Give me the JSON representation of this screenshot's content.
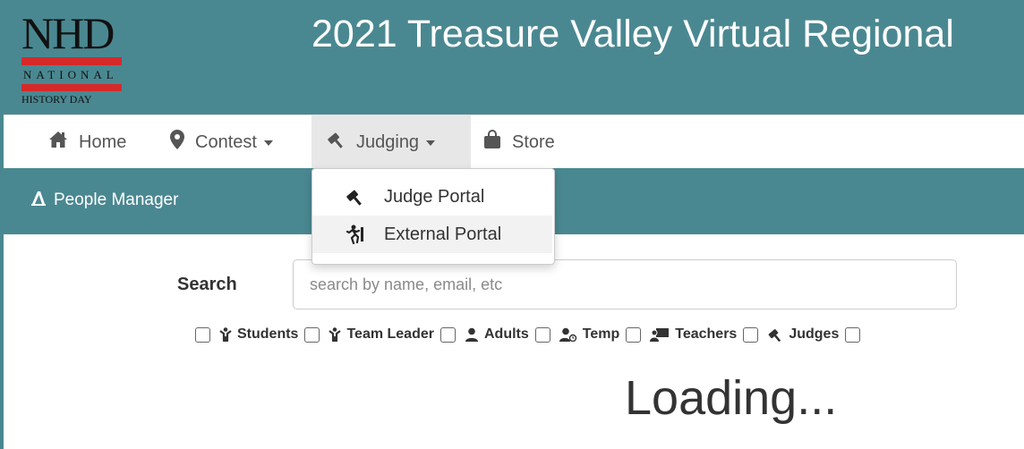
{
  "header": {
    "logo": {
      "main": "NHD",
      "line1": "NATIONAL",
      "line2": "HISTORY DAY"
    },
    "title": "2021 Treasure Valley Virtual Regional"
  },
  "nav": {
    "home": {
      "label": "Home",
      "icon": "home-icon"
    },
    "contest": {
      "label": "Contest",
      "icon": "map-marker-icon"
    },
    "judging": {
      "label": "Judging",
      "icon": "gavel-icon"
    },
    "store": {
      "label": "Store",
      "icon": "shopping-bag-icon"
    }
  },
  "dropdown": {
    "items": [
      {
        "label": "Judge Portal",
        "icon": "gavel-icon"
      },
      {
        "label": "External Portal",
        "icon": "running-person-icon"
      }
    ]
  },
  "subnav": {
    "people_manager": "People Manager"
  },
  "search": {
    "label": "Search",
    "placeholder": "search by name, email, etc",
    "value": ""
  },
  "filters": [
    {
      "label": "Students",
      "icon": "child-icon",
      "checked": false
    },
    {
      "label": "Team Leader",
      "icon": "child-icon",
      "checked": false
    },
    {
      "label": "Adults",
      "icon": "user-icon",
      "checked": false
    },
    {
      "label": "Temp",
      "icon": "user-clock-icon",
      "checked": false
    },
    {
      "label": "Teachers",
      "icon": "chalkboard-teacher-icon",
      "checked": false
    },
    {
      "label": "Judges",
      "icon": "gavel-icon",
      "checked": false
    }
  ],
  "status": {
    "loading_text": "Loading..."
  },
  "colors": {
    "brand_teal": "#4a8891",
    "logo_red": "#d42a2a",
    "text_dark": "#333333"
  }
}
